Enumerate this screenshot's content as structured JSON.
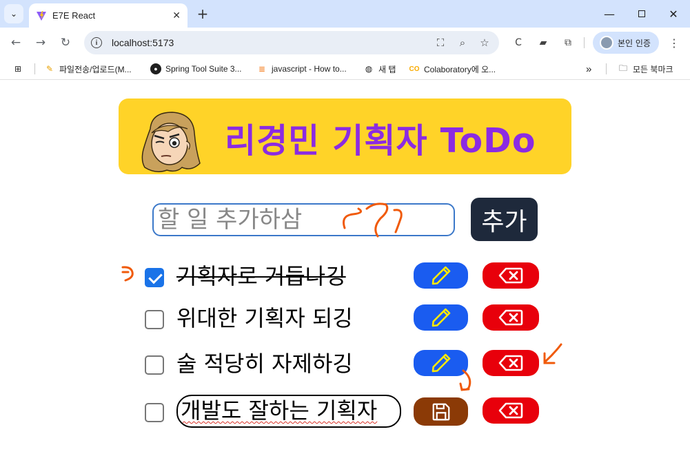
{
  "browser": {
    "tab_title": "E7E React",
    "url": "localhost:5173",
    "profile_label": "본인 인증",
    "bookmarks": [
      {
        "icon": "pencil-icon",
        "label": "파일전송/업로드(M..."
      },
      {
        "icon": "github-icon",
        "label": "Spring Tool Suite 3..."
      },
      {
        "icon": "stackoverflow-icon",
        "label": "javascript - How to..."
      },
      {
        "icon": "globe-icon",
        "label": "새 탭"
      },
      {
        "icon": "colab-icon",
        "label": "Colaboratory에 오..."
      }
    ],
    "all_bookmarks_label": "모든 북마크",
    "overflow_label": "»"
  },
  "app": {
    "title": "리경민 기획자 ToDo",
    "input_placeholder": "할 일 추가하삼",
    "add_button_label": "추가",
    "accent_color": "#8b2be2",
    "header_color": "#ffd328"
  },
  "todos": [
    {
      "text": "기획자로 거듭나깅",
      "done": true,
      "editing": false
    },
    {
      "text": "위대한 기획자 되깅",
      "done": false,
      "editing": false
    },
    {
      "text": "술 적당히 자제하깅",
      "done": false,
      "editing": false
    },
    {
      "text": "개발도 잘하는 기획자",
      "done": false,
      "editing": true
    }
  ]
}
